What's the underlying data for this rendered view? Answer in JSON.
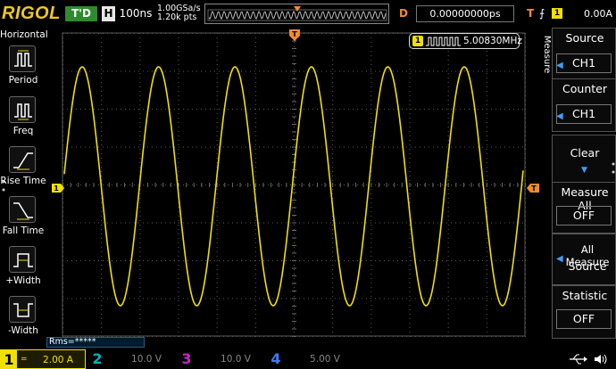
{
  "header": {
    "logo": "RIGOL",
    "run_state": "T'D",
    "horizontal_badge": "H",
    "timebase": "100ns",
    "sample_rate": "1.00GSa/s",
    "memory_depth": "1.20k pts",
    "delay_badge": "D",
    "delay": "0.00000000ps",
    "trigger_badge": "T",
    "trigger_edge": "⨍",
    "trigger_channel": "1",
    "trigger_level": "0.00A"
  },
  "left_menu": {
    "title": "Horizontal",
    "items": [
      {
        "label": "Period",
        "icon": "period-icon"
      },
      {
        "label": "Freq",
        "icon": "freq-icon"
      },
      {
        "label": "Rise Time",
        "icon": "rise-time-icon"
      },
      {
        "label": "Fall Time",
        "icon": "fall-time-icon"
      },
      {
        "label": "+Width",
        "icon": "positive-width-icon"
      },
      {
        "label": "-Width",
        "icon": "negative-width-icon"
      }
    ]
  },
  "display": {
    "trigger_position_marker": "T",
    "channel_marker": "1",
    "trigger_level_marker": "T",
    "measurement": {
      "channel": "1",
      "icon": "square-wave-icon",
      "value": "5.00830MHz"
    },
    "rms_label": "Rms=*****",
    "waveform_color": "#f0e000"
  },
  "right_menu": {
    "tab_label": "Measure",
    "items": [
      {
        "title": "Source",
        "value": "CH1"
      },
      {
        "title": "Counter",
        "value": "CH1"
      },
      {
        "title": "Clear",
        "value": ""
      },
      {
        "title": "Measure All",
        "value": "OFF"
      },
      {
        "title": "All Measure",
        "value": "Source"
      },
      {
        "title": "Statistic",
        "value": "OFF"
      }
    ]
  },
  "channels": [
    {
      "number": "1",
      "coupling": "=",
      "scale": "2.00 A",
      "color": "#f0e000",
      "active": true
    },
    {
      "number": "2",
      "coupling": "",
      "scale": "10.0 V",
      "color": "#00b4b4",
      "active": false
    },
    {
      "number": "3",
      "coupling": "",
      "scale": "10.0 V",
      "color": "#d020d0",
      "active": false
    },
    {
      "number": "4",
      "coupling": "",
      "scale": "5.00 V",
      "color": "#3a7cff",
      "active": false
    }
  ],
  "status": {
    "usb_icon": "usb-icon",
    "speaker_icon": "speaker-icon"
  }
}
